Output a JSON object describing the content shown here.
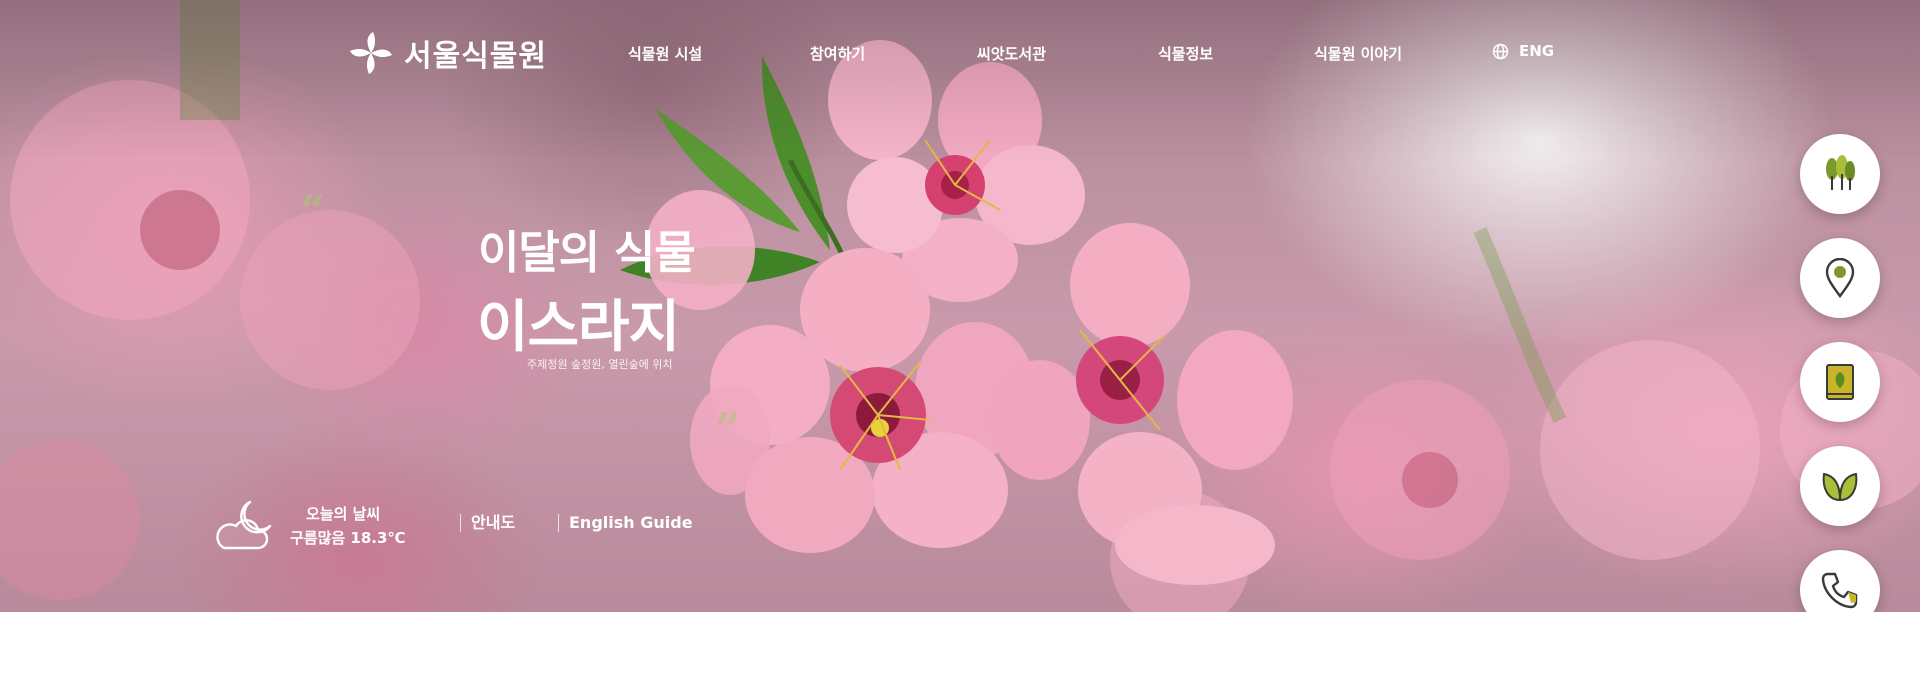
{
  "brand": {
    "name": "서울식물원",
    "logo_icon": "pinwheel-logo-icon"
  },
  "nav": {
    "items": [
      {
        "label": "식물원 시설"
      },
      {
        "label": "참여하기"
      },
      {
        "label": "씨앗도서관"
      },
      {
        "label": "식물정보"
      },
      {
        "label": "식물원 이야기"
      }
    ],
    "language": {
      "icon": "globe-icon",
      "label": "ENG"
    }
  },
  "featured": {
    "label": "이달의 식물",
    "title": "이스라지",
    "location": "주제정원 숲정원, 열린숲에 위치",
    "open_quote": "“",
    "close_quote": "”"
  },
  "weather": {
    "icon": "cloud-moon-icon",
    "label": "오늘의 날씨",
    "value": "구름많음 18.3℃"
  },
  "links": {
    "map": "안내도",
    "english_guide": "English Guide"
  },
  "quick_menu": [
    {
      "icon": "trees-icon"
    },
    {
      "icon": "location-pin-icon"
    },
    {
      "icon": "leaf-book-icon"
    },
    {
      "icon": "sprout-icon"
    },
    {
      "icon": "phone-icon"
    }
  ],
  "colors": {
    "accent_green": "#7a9a2e",
    "pin_yellow": "#c8b52a",
    "icon_dark": "#3a3a3a",
    "text_white": "#ffffff"
  }
}
